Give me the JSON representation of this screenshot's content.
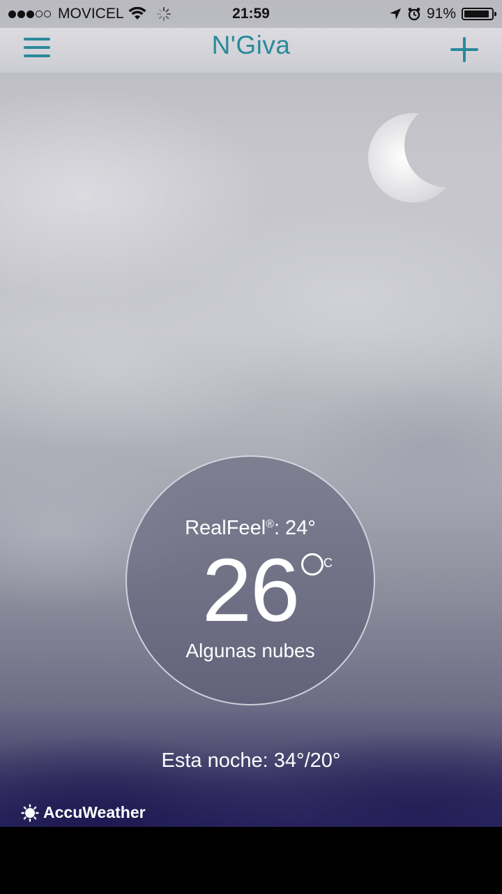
{
  "status_bar": {
    "carrier": "MOVICEL",
    "time": "21:59",
    "battery_percent": "91%",
    "battery_level": 0.91,
    "signal_bars_filled": 3,
    "signal_bars_total": 5
  },
  "nav": {
    "title": "N'Giva",
    "menu_icon": "hamburger-icon",
    "add_icon": "plus-icon"
  },
  "current": {
    "realfeel_label": "RealFeel",
    "realfeel_mark": "®",
    "realfeel_value": ": 24°",
    "temperature": "26",
    "unit": "C",
    "condition": "Algunas nubes"
  },
  "tonight": "Esta noche: 34°/20°",
  "brand": "AccuWeather",
  "colors": {
    "accent": "#2a8a99",
    "text_light": "#ffffff"
  }
}
